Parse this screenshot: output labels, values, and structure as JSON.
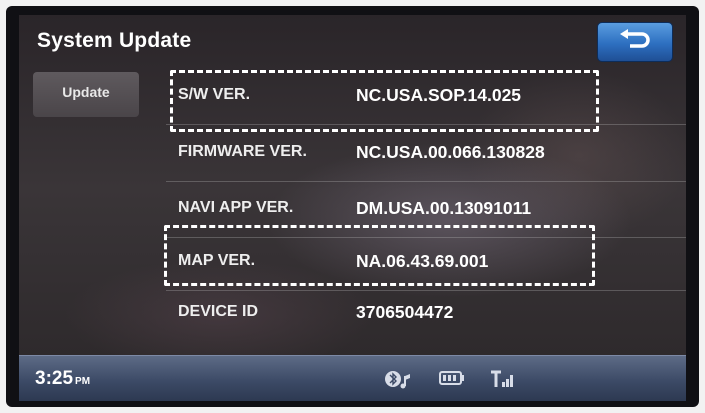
{
  "header": {
    "title": "System Update",
    "back_icon": "return-arrow-icon"
  },
  "sidebar": {
    "items": [
      {
        "label": "Update"
      }
    ]
  },
  "info_rows": [
    {
      "label": "S/W VER.",
      "value": "NC.USA.SOP.14.025"
    },
    {
      "label": "FIRMWARE VER.",
      "value": "NC.USA.00.066.130828"
    },
    {
      "label": "NAVI APP VER.",
      "value": "DM.USA.00.13091011"
    },
    {
      "label": "MAP VER.",
      "value": "NA.06.43.69.001"
    },
    {
      "label": "DEVICE ID",
      "value": "3706504472"
    }
  ],
  "status_bar": {
    "time": "3:25",
    "period": "PM",
    "icons": [
      "bluetooth-music-icon",
      "battery-icon",
      "signal-strength-icon"
    ]
  },
  "colors": {
    "accent_button": "#2d6fc0",
    "status_bar": "#3c4a66",
    "highlight_dash": "#ffffff"
  }
}
